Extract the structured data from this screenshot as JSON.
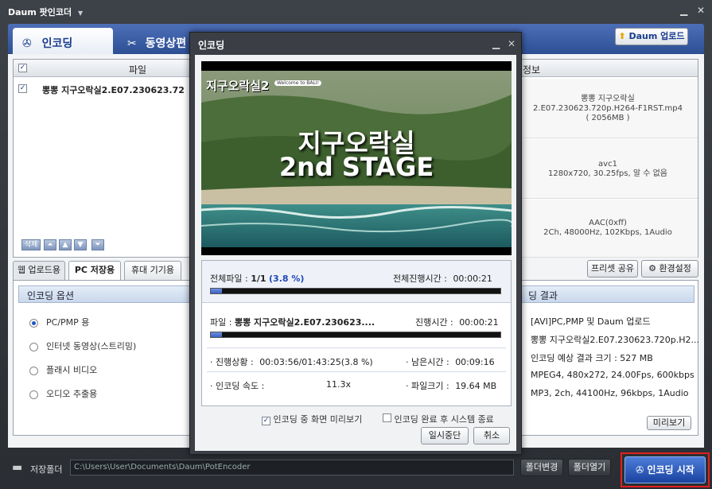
{
  "app": {
    "title": "Daum 팟인코더",
    "title_arrow": "▼",
    "min": "▁",
    "close": "✕"
  },
  "tabs": [
    {
      "label": "인코딩"
    },
    {
      "label": "동영상편"
    }
  ],
  "upload_button": "Daum 업로드",
  "file_list": {
    "header_file": "파일",
    "header_info": "정보",
    "rows": [
      {
        "name": "뽕뽕 지구오락실2.E07.230623.72"
      }
    ],
    "info_cells": [
      [
        "뽕뽕 지구오락실",
        "2.E07.230623.720p.H264-F1RST.mp4",
        "( 2056MB )"
      ],
      [
        "avc1",
        "1280x720, 30.25fps, 알 수 없음"
      ],
      [
        "AAC(0xff)",
        "2Ch, 48000Hz, 102Kbps, 1Audio"
      ]
    ],
    "delete_label": "삭제"
  },
  "option_tabs": [
    {
      "label": "웹 업로드용"
    },
    {
      "label": "PC 저장용"
    },
    {
      "label": "휴대 기기용"
    }
  ],
  "right_buttons": {
    "preset_share": "프리셋 공유",
    "settings": "환경설정"
  },
  "encoding_options": {
    "title": "인코딩 옵션",
    "items": [
      {
        "label": "PC/PMP 용"
      },
      {
        "label": "인터넷 동영상(스트리밍)"
      },
      {
        "label": "플래시 비디오"
      },
      {
        "label": "오디오 추출용"
      }
    ],
    "selected_index": 0
  },
  "result": {
    "title": "딩 결과",
    "lines": [
      "[AVI]PC,PMP 및 Daum 업로드",
      "뽕뽕 지구오락실2.E07.230623.720p.H2...",
      "인코딩 예상 결과 크기 : 527 MB",
      "MPEG4, 480x272, 24.00Fps, 600kbps",
      "MP3, 2ch, 44100Hz, 96kbps, 1Audio"
    ],
    "preview_button": "미리보기"
  },
  "bottom": {
    "folder_label": "저장폴더",
    "path": "C:\\Users\\User\\Documents\\Daum\\PotEncoder",
    "change_folder": "폴더변경",
    "open_folder": "폴더열기",
    "start": "인코딩 시작"
  },
  "dialog": {
    "title": "인코딩",
    "min": "▁",
    "close": "✕",
    "preview": {
      "line1": "지구오락실",
      "line2": "2nd STAGE",
      "logo": "지구오락실2",
      "badge": "Welcome to BALI!"
    },
    "total_files_label": "전체파일 :",
    "total_files_value": "1/1",
    "total_percent": "(3.8 %)",
    "total_time_label": "전체진행시간 :",
    "total_time_value": "00:00:21",
    "file_label": "파일 :",
    "file_name": "뽕뽕 지구오락실2.E07.230623....",
    "progress_time_label": "진행시간 :",
    "progress_time_value": "00:00:21",
    "status_label": "· 진행상황 :",
    "status_value": "00:03:56/01:43:25(3.8 %)",
    "remaining_label": "· 남은시간 :",
    "remaining_value": "00:09:16",
    "speed_label": "· 인코딩 속도 :",
    "speed_value": "11.3x",
    "filesize_label": "· 파일크기 :",
    "filesize_value": "19.64 MB",
    "preview_check": "인코딩 중 화면 미리보기",
    "shutdown_check": "인코딩 완료 후 시스템 종료",
    "pause": "일시중단",
    "cancel": "취소",
    "total_progress": 0.038,
    "file_progress": 0.038
  }
}
